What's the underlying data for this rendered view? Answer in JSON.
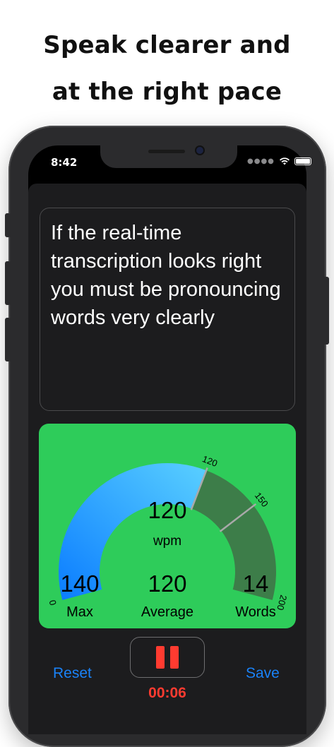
{
  "headline": {
    "line1": "Speak clearer and",
    "line2": "at the right pace"
  },
  "status_bar": {
    "time": "8:42",
    "signal_icon": "signal-dots-icon",
    "wifi_icon": "wifi-icon",
    "battery_icon": "battery-icon"
  },
  "transcript": {
    "text": "If the real-time transcription looks right you must be pronouncing words very clearly"
  },
  "meter": {
    "background": "#2ecc5a",
    "wpm_value": "120",
    "wpm_unit": "wpm",
    "scale": {
      "min": "0",
      "mark1": "120",
      "mark2": "150",
      "max": "200"
    },
    "current_wpm_fraction_of_max": 0.6,
    "stats": [
      {
        "value": "140",
        "label": "Max"
      },
      {
        "value": "120",
        "label": "Average"
      },
      {
        "value": "14",
        "label": "Words"
      }
    ]
  },
  "controls": {
    "reset_label": "Reset",
    "save_label": "Save",
    "pause_icon": "pause-icon",
    "timer": "00:06"
  },
  "colors": {
    "accent_blue": "#1a82f7",
    "record_red": "#ff3b30"
  }
}
